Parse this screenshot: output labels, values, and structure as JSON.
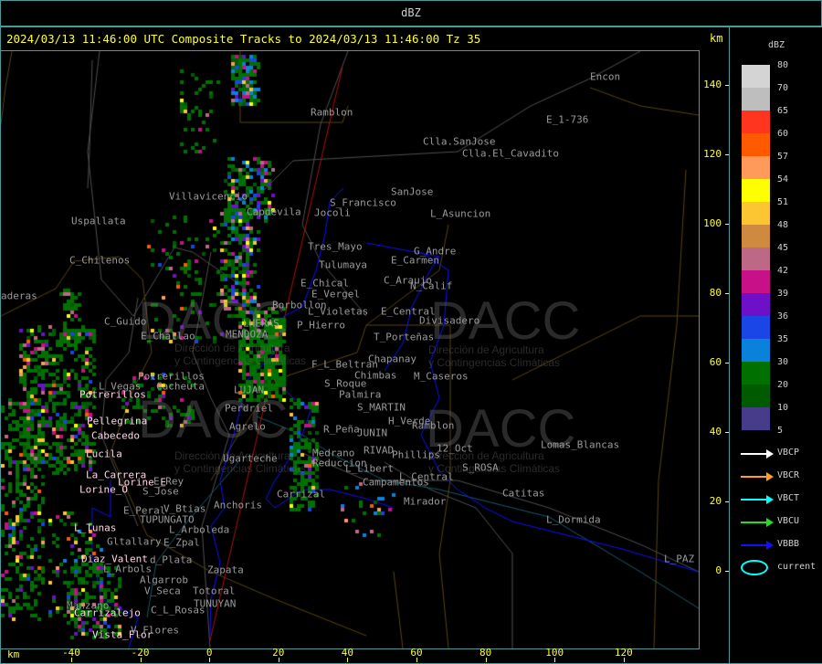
{
  "header": {
    "title": "dBZ"
  },
  "plot": {
    "title": "2024/03/13 11:46:00 UTC Composite Tracks to 2024/03/13 11:46:00 Tz 35",
    "km_label_top": "km",
    "km_label_bottom": "km",
    "x_ticks": [
      "-40",
      "-20",
      "0",
      "20",
      "40",
      "60",
      "80",
      "100",
      "120"
    ],
    "y_ticks": [
      "140",
      "120",
      "100",
      "80",
      "60",
      "40",
      "20",
      "0"
    ]
  },
  "legend": {
    "title": "dBZ",
    "scale": [
      {
        "label": "80",
        "color": "#d4d4d4"
      },
      {
        "label": "70",
        "color": "#bebebe"
      },
      {
        "label": "65",
        "color": "#ff3520"
      },
      {
        "label": "60",
        "color": "#ff5a00"
      },
      {
        "label": "57",
        "color": "#ff9a5a"
      },
      {
        "label": "54",
        "color": "#ffff00"
      },
      {
        "label": "51",
        "color": "#fcc632"
      },
      {
        "label": "48",
        "color": "#d08a40"
      },
      {
        "label": "45",
        "color": "#be6888"
      },
      {
        "label": "42",
        "color": "#c81088"
      },
      {
        "label": "39",
        "color": "#6e10c8"
      },
      {
        "label": "36",
        "color": "#1a46e6"
      },
      {
        "label": "35",
        "color": "#0a82dc"
      },
      {
        "label": "30",
        "color": "#007000"
      },
      {
        "label": "20",
        "color": "#005a00"
      },
      {
        "label": "10",
        "color": "#463c8a"
      },
      {
        "label": "5",
        "color": ""
      }
    ],
    "tracks": [
      {
        "label": "VBCP",
        "color": "#ffffff"
      },
      {
        "label": "VBCR",
        "color": "#ffa020"
      },
      {
        "label": "VBCT",
        "color": "#00ffff"
      },
      {
        "label": "VBCU",
        "color": "#20e020"
      },
      {
        "label": "VBBB",
        "color": "#1010ff"
      }
    ],
    "current": {
      "label": "current",
      "color": "#00ffff"
    }
  },
  "watermark": {
    "logo": "DACC",
    "line1": "Dirección de Agricultura",
    "line2": "y Contingencias Climáticas"
  },
  "places": [
    "Ramblon",
    "Clla.SanJose",
    "Clla.El_Cavadito",
    "SanJose",
    "S_Francisco",
    "Jocoli",
    "L_Asuncion",
    "Uspallata",
    "Villavicencio",
    "Capdevila",
    "C_Chilenos",
    "Tres_Mayo",
    "Tulumaya",
    "G_Andre",
    "E_Carmen",
    "C_Araujo",
    "N_Calif",
    "E_Chical",
    "E_Vergel",
    "Borbollon",
    "L_Violetas",
    "E_Central",
    "Divisadero",
    "P_Hierro",
    "LHERAS",
    "C_Guido",
    "E_Challao",
    "MENDOZA",
    "T_Porteñas",
    "Chapanay",
    "F_L_Beltran",
    "Chimbas",
    "M_Caseros",
    "S_Roque",
    "Potrerillos",
    "L_Vegas",
    "Cacheuta",
    "Palmira",
    "S_MARTIN",
    "H_Verde",
    "Ramblon",
    "R_Peña",
    "JUNIN",
    "Perdriel",
    "Agrelo",
    "Medrano",
    "RIVAD",
    "Phillips",
    "12_Oct",
    "Lomas_Blancas",
    "Ugarteche",
    "Reduccion",
    "L_Libert",
    "S_ROSA",
    "E_Rey",
    "L_Central",
    "Campamentos",
    "S_Jose",
    "Carrizal",
    "Mirador",
    "Catitas",
    "Anchoris",
    "E_Peral",
    "V_Btias",
    "TUPUNGATO",
    "L_Dormida",
    "L_Arboleda",
    "Gltallary",
    "E_Zpal",
    "d_Plata",
    "L_PAZ",
    "L_Arbols",
    "Zapata",
    "Algarrob",
    "V_Seca",
    "Totoral",
    "TUNUYAN",
    "Manzano",
    "C_L_Rosas",
    "V_Flores",
    "Encon",
    "E_1-736",
    "aderas",
    "LUJAN"
  ],
  "stations": [
    "Potrerillos",
    "Pellegrina",
    "Cabecedo",
    "Lucila",
    "La_Carrera",
    "Lorine_E",
    "Lorine_O",
    "L_Tunas",
    "Diaz_Valent",
    "Carrizalejo",
    "Vista_Flor"
  ]
}
